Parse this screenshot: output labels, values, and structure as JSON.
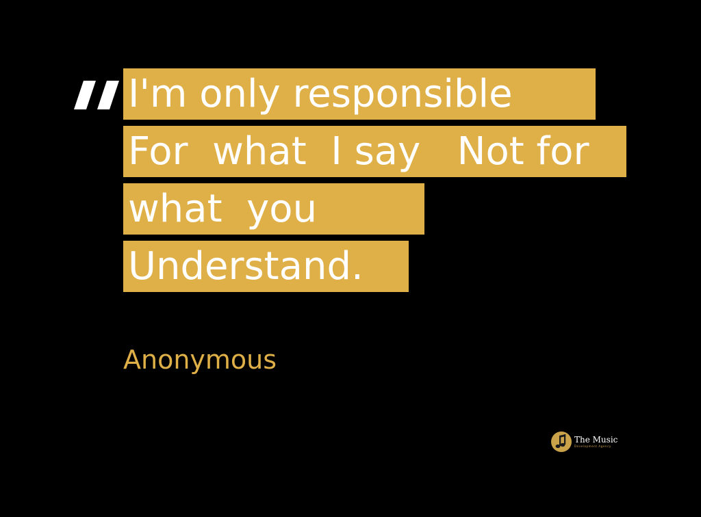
{
  "colors": {
    "background": "#000000",
    "highlight": "#e0b048",
    "quote_text": "#ffffff",
    "attribution": "#e0b048"
  },
  "quote": {
    "icon": "quote-mark-icon",
    "lines": [
      "I'm only responsible",
      "For  what  I say   Not for",
      "what  you",
      "Understand."
    ]
  },
  "attribution": "Anonymous",
  "logo": {
    "icon": "music-note-icon",
    "name": "The Music",
    "subtitle": "Development Agency"
  }
}
